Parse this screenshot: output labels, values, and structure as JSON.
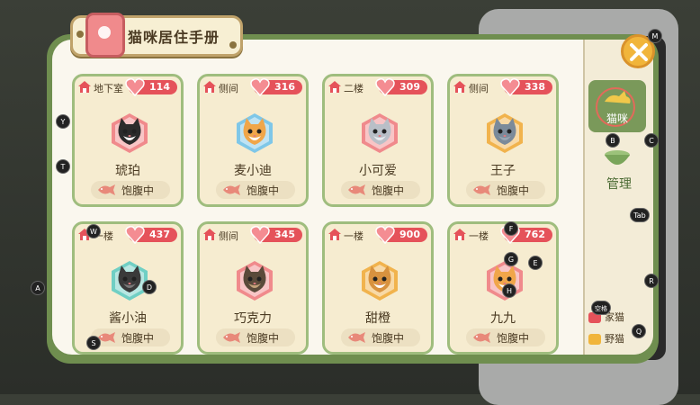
{
  "title": "猫咪居住手册",
  "colors": {
    "accent_green": "#6f8e4f",
    "card_bg": "#f6ecd0",
    "heart_red": "#e5525a"
  },
  "cats": [
    {
      "location": "地下室",
      "love": "114",
      "name": "琥珀",
      "status": "饱腹中",
      "fur": "#2b2b2b",
      "fur2": "#ffffff",
      "hex": "#f08a8c"
    },
    {
      "location": "侧间",
      "love": "316",
      "name": "麦小迪",
      "status": "饱腹中",
      "fur": "#f0a64a",
      "fur2": "#ffffff",
      "hex": "#7fc7e8"
    },
    {
      "location": "二楼",
      "love": "309",
      "name": "小可爱",
      "status": "饱腹中",
      "fur": "#b9bfc7",
      "fur2": "#e8ebef",
      "hex": "#f08a8c"
    },
    {
      "location": "侧间",
      "love": "338",
      "name": "王子",
      "status": "饱腹中",
      "fur": "#7b8a9a",
      "fur2": "#9aa7b3",
      "hex": "#f1b34d"
    },
    {
      "location": "一楼",
      "love": "437",
      "name": "酱小油",
      "status": "饱腹中",
      "fur": "#3a3a3a",
      "fur2": "#7a7a7a",
      "hex": "#70cfc4"
    },
    {
      "location": "侧间",
      "love": "345",
      "name": "巧克力",
      "status": "饱腹中",
      "fur": "#5a4a3a",
      "fur2": "#c4a27a",
      "hex": "#f08a8c"
    },
    {
      "location": "一楼",
      "love": "900",
      "name": "甜橙",
      "status": "饱腹中",
      "fur": "#d8923f",
      "fur2": "#ffffff",
      "hex": "#f1b34d"
    },
    {
      "location": "一楼",
      "love": "762",
      "name": "九九",
      "status": "饱腹中",
      "fur": "#f0a64a",
      "fur2": "#ffffff",
      "hex": "#f08a8c"
    }
  ],
  "side": {
    "cat_label": "猫咪",
    "manage_label": "管理",
    "legend_home": "家猫",
    "legend_wild": "野猫"
  },
  "hints": {
    "M": "M",
    "Y": "Y",
    "T": "T",
    "A": "A",
    "W": "W",
    "S": "S",
    "D": "D",
    "B": "B",
    "C": "C",
    "Tab": "Tab",
    "F": "F",
    "G": "G",
    "E": "E",
    "H": "H",
    "R": "R",
    "Q": "Q",
    "Space": "空格"
  }
}
